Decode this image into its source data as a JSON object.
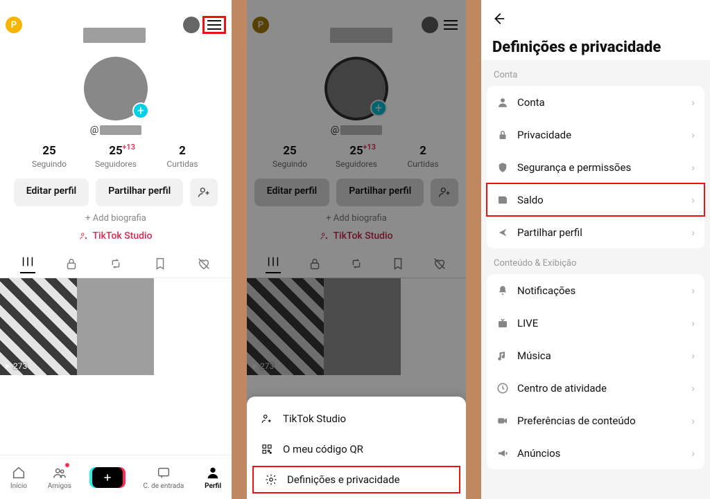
{
  "panel1": {
    "handle_prefix": "@",
    "stats": {
      "following": {
        "num": "25",
        "label": "Seguindo"
      },
      "followers": {
        "num": "25",
        "label": "Seguidores",
        "badge": "+13"
      },
      "likes": {
        "num": "2",
        "label": "Curtidas"
      }
    },
    "buttons": {
      "edit": "Editar perfil",
      "share": "Partilhar perfil"
    },
    "addBio": "+ Add biografia",
    "studio": "TikTok Studio",
    "thumbPlays": "273",
    "nav": {
      "home": "Início",
      "friends": "Amigos",
      "inbox": "C. de entrada",
      "profile": "Perfil"
    }
  },
  "panel2": {
    "sheet": {
      "studio": "TikTok Studio",
      "qr": "O meu código QR",
      "settings": "Definições e privacidade"
    }
  },
  "panel3": {
    "title": "Definições e privacidade",
    "section1": "Conta",
    "rows1": {
      "account": "Conta",
      "privacy": "Privacidade",
      "security": "Segurança e permissões",
      "balance": "Saldo",
      "share": "Partilhar perfil"
    },
    "section2": "Conteúdo & Exibição",
    "rows2": {
      "notifications": "Notificações",
      "live": "LIVE",
      "music": "Música",
      "activity": "Centro de atividade",
      "contentPref": "Preferências de conteúdo",
      "ads": "Anúncios"
    }
  }
}
